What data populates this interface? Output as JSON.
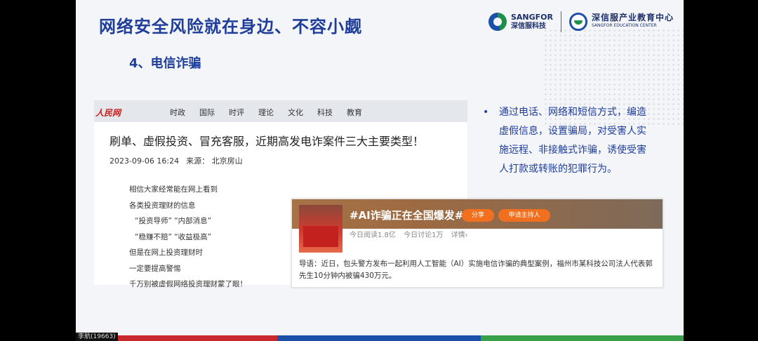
{
  "slide": {
    "title": "网络安全风险就在身边、不容小觑",
    "section_title": "4、电信诈骗",
    "logo": {
      "brand_en": "SANGFOR",
      "brand_cn": "深信服科技",
      "edu_cn": "深信服产业教育中心",
      "edu_en": "SANGFOR EDUCATION CENTER"
    },
    "bullet_text": "通过电话、网络和短信方式，编造虚假信息，设置骗局，对受害人实施远程、非接触式诈骗，诱使受害人打款或转账的犯罪行为。"
  },
  "news": {
    "site_logo": "人民网",
    "nav": [
      "时政",
      "国际",
      "时评",
      "理论",
      "文化",
      "科技",
      "教育"
    ],
    "headline": "刷单、虚假投资、冒充客服，近期高发电诈案件三大主要类型！",
    "date": "2023-09-06 16:24",
    "source": "来源：  北京房山",
    "lines": [
      "相信大家经常能在网上看到",
      "各类投资理财的信息",
      "“投资导师”  “内部消息”",
      "“稳赚不赔”  “收益极高”",
      "但是在网上投资理财时",
      "一定要提高警惕",
      "千万别被虚假网络投资理财蒙了眼！"
    ]
  },
  "topic": {
    "title": "#AI诈骗正在全国爆发#",
    "share_label": "分享",
    "host_label": "申请主持人",
    "reads": "今日阅读1.8亿",
    "discussions": "今日讨论1万",
    "detail": "详情›",
    "intro": "导语：近日，包头警方发布一起利用人工智能（AI）实施电信诈骗的典型案例，福州市某科技公司法人代表郭先生10分钟内被骗430万元。"
  },
  "viewer_label": "李航(19663)",
  "colors": {
    "title_blue": "#1e3e9a",
    "accent_orange": "#f0701f",
    "bar_red": "#c8282e",
    "bar_blue": "#1b4fa8",
    "bar_green": "#39a04a"
  }
}
